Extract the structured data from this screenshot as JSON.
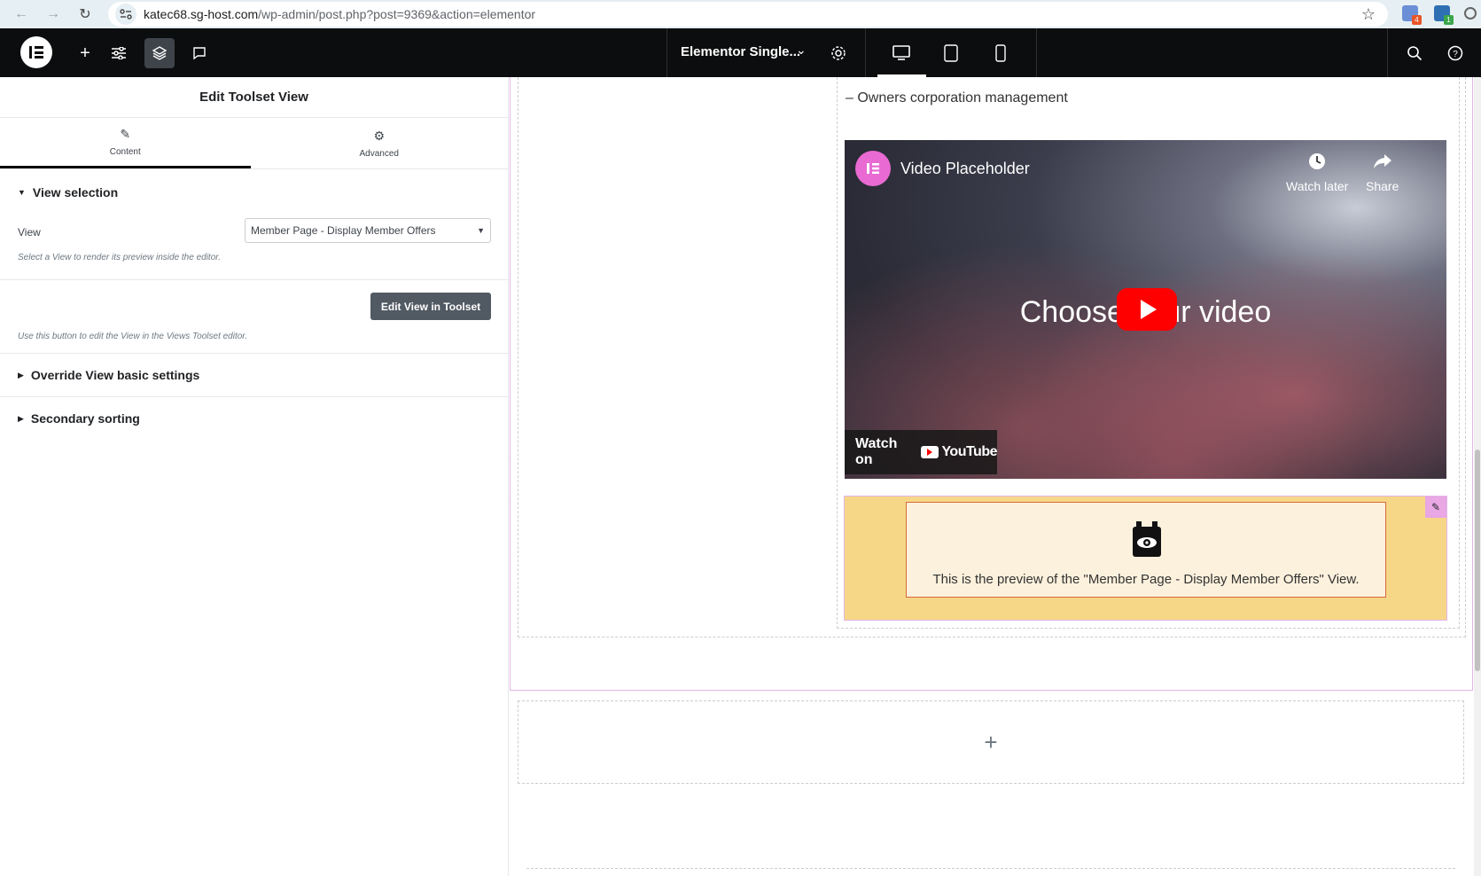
{
  "browser": {
    "url_host": "katec68.sg-host.com",
    "url_path": "/wp-admin/post.php?post=9369&action=elementor",
    "ext1_badge": "4",
    "ext2_badge": "1"
  },
  "topbar": {
    "document_title": "Elementor Single...",
    "icons": [
      "plus-icon",
      "sliders-icon",
      "layers-icon",
      "comment-icon",
      "settings-icon",
      "desktop-icon",
      "tablet-icon",
      "mobile-icon",
      "search-icon",
      "help-icon"
    ]
  },
  "panel": {
    "title": "Edit Toolset View",
    "tabs": [
      {
        "label": "Content",
        "icon": "pencil-icon"
      },
      {
        "label": "Advanced",
        "icon": "gear-icon"
      }
    ],
    "view_selection": {
      "heading": "View selection",
      "view_label": "View",
      "view_value": "Member Page - Display Member Offers",
      "view_hint": "Select a View to render its preview inside the editor."
    },
    "edit_button_label": "Edit View in Toolset",
    "edit_hint": "Use this button to edit the View in the Views Toolset editor.",
    "sections": [
      {
        "heading": "Override View basic settings"
      },
      {
        "heading": "Secondary sorting"
      }
    ]
  },
  "canvas": {
    "owners_text": "– Owners corporation management",
    "video": {
      "title": "Video Placeholder",
      "watch_later": "Watch later",
      "share": "Share",
      "center_text": "Choose your video",
      "watch_on": "Watch on",
      "youtube_word": "YouTube"
    },
    "toolset_preview_text": "This is the preview of the \"Member Page - Display Member Offers\" View.",
    "add_section_symbol": "+"
  },
  "colors": {
    "elementor_dark": "#0c0d0e",
    "widget_background": "#f6d788",
    "preview_border": "#d66a3c",
    "youtube_red": "#ff0000",
    "elementor_pink": "#e86ad2"
  }
}
